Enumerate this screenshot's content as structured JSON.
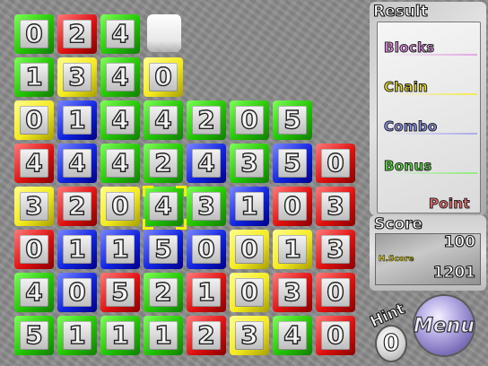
{
  "board": {
    "rows": [
      [
        {
          "n": "0",
          "c": "green"
        },
        {
          "n": "2",
          "c": "red"
        },
        {
          "n": "4",
          "c": "green"
        },
        {
          "n": "",
          "c": "empty"
        },
        {
          "n": "",
          "c": "empty"
        },
        {
          "n": "",
          "c": "empty"
        },
        {
          "n": "",
          "c": "empty"
        },
        {
          "n": "",
          "c": "empty"
        }
      ],
      [
        {
          "n": "1",
          "c": "green"
        },
        {
          "n": "3",
          "c": "yellow"
        },
        {
          "n": "4",
          "c": "green"
        },
        {
          "n": "0",
          "c": "yellow"
        },
        {
          "n": "",
          "c": "empty"
        },
        {
          "n": "",
          "c": "empty"
        },
        {
          "n": "",
          "c": "empty"
        },
        {
          "n": "",
          "c": "empty"
        }
      ],
      [
        {
          "n": "0",
          "c": "yellow"
        },
        {
          "n": "1",
          "c": "blue"
        },
        {
          "n": "4",
          "c": "green"
        },
        {
          "n": "4",
          "c": "green"
        },
        {
          "n": "2",
          "c": "green"
        },
        {
          "n": "0",
          "c": "green"
        },
        {
          "n": "5",
          "c": "green"
        },
        {
          "n": "",
          "c": "empty"
        }
      ],
      [
        {
          "n": "4",
          "c": "red"
        },
        {
          "n": "4",
          "c": "blue"
        },
        {
          "n": "4",
          "c": "green"
        },
        {
          "n": "2",
          "c": "green"
        },
        {
          "n": "4",
          "c": "blue"
        },
        {
          "n": "3",
          "c": "green"
        },
        {
          "n": "5",
          "c": "blue"
        },
        {
          "n": "0",
          "c": "red"
        }
      ],
      [
        {
          "n": "3",
          "c": "yellow"
        },
        {
          "n": "2",
          "c": "red"
        },
        {
          "n": "0",
          "c": "yellow"
        },
        {
          "n": "4",
          "c": "green"
        },
        {
          "n": "3",
          "c": "green"
        },
        {
          "n": "1",
          "c": "blue"
        },
        {
          "n": "0",
          "c": "red"
        },
        {
          "n": "3",
          "c": "red"
        }
      ],
      [
        {
          "n": "0",
          "c": "red"
        },
        {
          "n": "1",
          "c": "blue"
        },
        {
          "n": "1",
          "c": "blue"
        },
        {
          "n": "5",
          "c": "blue"
        },
        {
          "n": "0",
          "c": "blue"
        },
        {
          "n": "0",
          "c": "yellow"
        },
        {
          "n": "1",
          "c": "yellow"
        },
        {
          "n": "3",
          "c": "red"
        }
      ],
      [
        {
          "n": "4",
          "c": "green"
        },
        {
          "n": "0",
          "c": "blue"
        },
        {
          "n": "5",
          "c": "red"
        },
        {
          "n": "2",
          "c": "green"
        },
        {
          "n": "1",
          "c": "red"
        },
        {
          "n": "0",
          "c": "yellow"
        },
        {
          "n": "3",
          "c": "red"
        },
        {
          "n": "0",
          "c": "red"
        }
      ],
      [
        {
          "n": "5",
          "c": "green"
        },
        {
          "n": "1",
          "c": "green"
        },
        {
          "n": "1",
          "c": "green"
        },
        {
          "n": "1",
          "c": "green"
        },
        {
          "n": "2",
          "c": "red"
        },
        {
          "n": "3",
          "c": "yellow"
        },
        {
          "n": "4",
          "c": "green"
        },
        {
          "n": "0",
          "c": "red"
        }
      ]
    ],
    "cursor": {
      "row": 4,
      "col": 3
    }
  },
  "result": {
    "title": "Result",
    "items": [
      {
        "label": "Blocks",
        "color": "#e48ce4",
        "line": "#e0a8e0"
      },
      {
        "label": "Chain",
        "color": "#f0e020",
        "line": "#f4ec50"
      },
      {
        "label": "Combo",
        "color": "#8a90f0",
        "line": "#a8acf0"
      },
      {
        "label": "Bonus",
        "color": "#58e040",
        "line": "#90ec80"
      },
      {
        "label": "Point",
        "color": "#ee6a6a",
        "line": "#ee8a8a"
      }
    ]
  },
  "score": {
    "title": "Score",
    "value": "100",
    "hiscore_label": "H.Score",
    "hiscore_value": "1201"
  },
  "hint": {
    "label": "Hint",
    "count": "0"
  },
  "menu": {
    "label": "Menu"
  },
  "colors": {
    "green": "#22c400",
    "red": "#e01010",
    "blue": "#1024e0",
    "yellow": "#f4ea20",
    "hiscore": "#e8d400"
  }
}
